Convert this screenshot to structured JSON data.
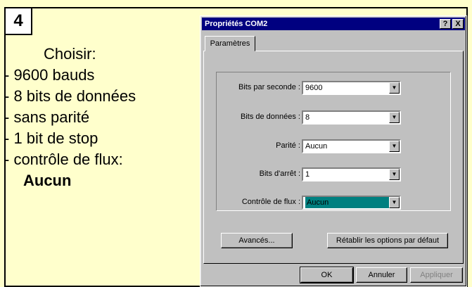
{
  "step": {
    "number": "4"
  },
  "instructions": {
    "title": "Choisir:",
    "items": [
      "- 9600 bauds",
      "- 8 bits de données",
      "- sans parité",
      "- 1 bit de stop",
      "- contrôle de flux:"
    ],
    "emphasis": "Aucun"
  },
  "dialog": {
    "title": "Propriétés COM2",
    "help_label": "?",
    "close_label": "X",
    "tab_label": "Paramètres",
    "fields": [
      {
        "label": "Bits par seconde :",
        "value": "9600"
      },
      {
        "label": "Bits de données :",
        "value": "8"
      },
      {
        "label": "Parité :",
        "value": "Aucun"
      },
      {
        "label": "Bits d'arrêt :",
        "value": "1"
      },
      {
        "label": "Contrôle de flux :",
        "value": "Aucun"
      }
    ],
    "advanced_label": "Avancés...",
    "restore_label": "Rétablir les options par défaut",
    "ok_label": "OK",
    "cancel_label": "Annuler",
    "apply_label": "Appliquer"
  },
  "colors": {
    "background": "#ffffcc",
    "titlebar": "#000080",
    "selection": "#008080"
  }
}
